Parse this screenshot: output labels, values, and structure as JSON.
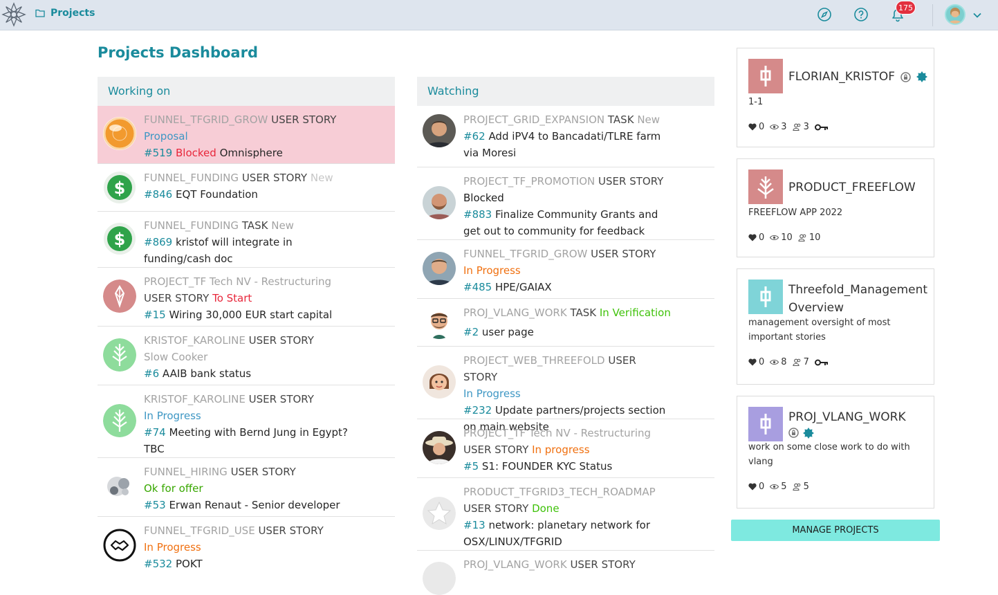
{
  "nav": {
    "crumb": "Projects",
    "notif_count": "175"
  },
  "page_title": "Projects Dashboard",
  "working": {
    "heading": "Working on",
    "rows": [
      {
        "project": "FUNNEL_TFGRID_GROW",
        "kind": "USER STORY",
        "status": "Proposal",
        "num": "#519",
        "status2": "Blocked",
        "title": "Omnisphere"
      },
      {
        "project": "FUNNEL_FUNDING",
        "kind": "USER STORY",
        "status": "New",
        "num": "#846",
        "title": "EQT Foundation"
      },
      {
        "project": "FUNNEL_FUNDING",
        "kind": "TASK",
        "status": "New",
        "num": "#869",
        "title": "kristof will integrate in funding/cash doc"
      },
      {
        "project": "PROJECT_TF Tech NV - Restructuring",
        "kind": "USER STORY",
        "status": "To Start",
        "num": "#15",
        "title": "Wiring 30,000 EUR start capital"
      },
      {
        "project": "KRISTOF_KAROLINE",
        "kind": "USER STORY",
        "status": "Slow Cooker",
        "num": "#6",
        "title": "AAIB bank status"
      },
      {
        "project": "KRISTOF_KAROLINE",
        "kind": "USER STORY",
        "status": "In Progress",
        "num": "#74",
        "title": "Meeting with Bernd Jung in Egypt? TBC"
      },
      {
        "project": "FUNNEL_HIRING",
        "kind": "USER STORY",
        "status": "Ok for offer",
        "num": "#53",
        "title": "Erwan Renaut - Senior developer"
      },
      {
        "project": "FUNNEL_TFGRID_USE",
        "kind": "USER STORY",
        "status": "In Progress",
        "num": "#532",
        "title": "POKT"
      }
    ]
  },
  "watching": {
    "heading": "Watching",
    "rows": [
      {
        "project": "PROJECT_GRID_EXPANSION",
        "kind": "TASK",
        "status": "New",
        "num": "#62",
        "title": "Add iPV4 to Bancadati/TLRE farm via Moresi"
      },
      {
        "project": "PROJECT_TF_PROMOTION",
        "kind": "USER STORY",
        "status": "Blocked",
        "num": "#883",
        "title": "Finalize Community Grants and get out to community for feedback"
      },
      {
        "project": "FUNNEL_TFGRID_GROW",
        "kind": "USER STORY",
        "status": "In Progress",
        "num": "#485",
        "title": "HPE/GAIAX"
      },
      {
        "project": "PROJ_VLANG_WORK",
        "kind": "TASK",
        "status": "In Verification",
        "num": "#2",
        "title": "user page"
      },
      {
        "project": "PROJECT_WEB_THREEFOLD",
        "kind": "USER STORY",
        "status": "In Progress",
        "num": "#232",
        "title": "Update partners/projects section on main website"
      },
      {
        "project": "PROJECT_TF Tech NV - Restructuring",
        "kind": "USER STORY",
        "status": "In progress",
        "num": "#5",
        "title": "S1: FOUNDER KYC Status"
      },
      {
        "project": "PRODUCT_TFGRID3_TECH_ROADMAP",
        "kind": "USER STORY",
        "status": "Done",
        "num": "#13",
        "title": "network: planetary network for OSX/LINUX/TFGRID"
      },
      {
        "project": "PROJ_VLANG_WORK",
        "kind": "USER STORY"
      }
    ]
  },
  "projects": [
    {
      "name": "FLORIAN_KRISTOF",
      "desc": "1-1",
      "likes": "0",
      "watchers": "3",
      "members": "3"
    },
    {
      "name": "PRODUCT_FREEFLOW",
      "desc": "FREEFLOW APP 2022",
      "likes": "0",
      "watchers": "10",
      "members": "10"
    },
    {
      "name": "Threefold_Management Overview",
      "desc": "management oversight of most important stories",
      "likes": "0",
      "watchers": "8",
      "members": "7"
    },
    {
      "name": "PROJ_VLANG_WORK",
      "desc": "work on some close work to do with vlang",
      "likes": "0",
      "watchers": "5",
      "members": "5"
    }
  ],
  "manage_label": "MANAGE PROJECTS",
  "colors": {
    "accent": "#1a8b9c",
    "highlight": "#f7cdd6",
    "button": "#7ee9e0",
    "badge": "#e2303f"
  },
  "icons": [
    "logo-icon",
    "folder-icon",
    "compass-icon",
    "help-icon",
    "bell-icon",
    "chevron-down-icon",
    "heart-icon",
    "eye-icon",
    "members-icon",
    "key-icon",
    "lock-icon",
    "badge-icon"
  ]
}
